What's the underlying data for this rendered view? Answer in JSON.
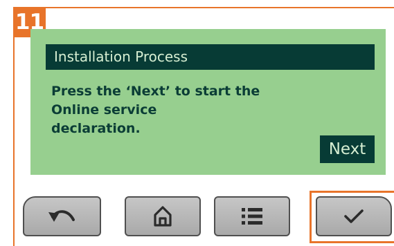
{
  "step": {
    "number": "11"
  },
  "screen": {
    "header": "Installation Process",
    "message_lines": [
      "Press the ‘Next’ to start the",
      "Online service",
      "declaration."
    ],
    "next_label": "Next"
  },
  "buttons": [
    {
      "name": "back",
      "icon": "undo-arrow-icon"
    },
    {
      "name": "home",
      "icon": "home-icon"
    },
    {
      "name": "menu",
      "icon": "list-icon"
    },
    {
      "name": "ok",
      "icon": "checkmark-icon",
      "highlighted": true
    }
  ],
  "colors": {
    "accent": "#e8742a",
    "screen_background": "#97cf8f",
    "screen_dark": "#073b35",
    "screen_text": "#0b3d36",
    "button_grey": "#b8b8b8"
  }
}
